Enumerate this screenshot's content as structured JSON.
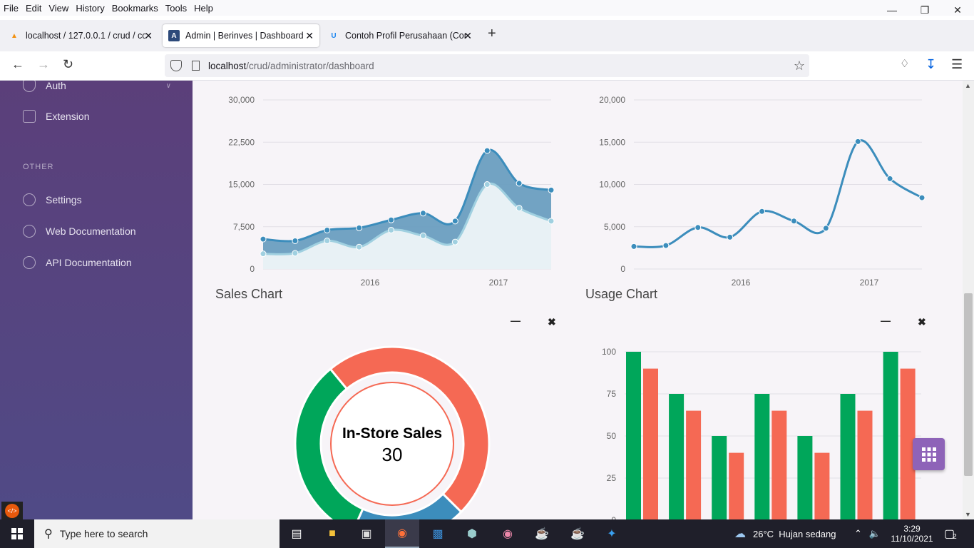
{
  "menubar": {
    "items": [
      "File",
      "Edit",
      "View",
      "History",
      "Bookmarks",
      "Tools",
      "Help"
    ]
  },
  "tabs": [
    {
      "label": "localhost / 127.0.0.1 / crud / cc_",
      "active": false
    },
    {
      "label": "Admin | Berinves | Dashboard",
      "active": true
    },
    {
      "label": "Contoh Profil Perusahaan (Com",
      "active": false
    }
  ],
  "url": {
    "host": "localhost",
    "path": "/crud/administrator/dashboard"
  },
  "sidebar": {
    "items_top": [
      {
        "label": "Auth"
      },
      {
        "label": "Extension"
      }
    ],
    "section": "OTHER",
    "items_other": [
      {
        "label": "Settings"
      },
      {
        "label": "Web Documentation"
      },
      {
        "label": "API Documentation"
      }
    ]
  },
  "charts": {
    "sales_title": "Sales Chart",
    "usage_title": "Usage Chart",
    "donut_label": "In-Store Sales",
    "donut_value": "30"
  },
  "chart_data": [
    {
      "type": "area",
      "x_ticks": [
        "2016",
        "2017"
      ],
      "y_ticks": [
        "0",
        "7,500",
        "15,000",
        "22,500",
        "30,000"
      ],
      "ylim": [
        0,
        30000
      ],
      "series": [
        {
          "values": [
            5300,
            5000,
            6900,
            7300,
            8700,
            9900,
            8500,
            21000,
            15200,
            14000
          ],
          "color": "#3c8dbc"
        },
        {
          "values": [
            2700,
            2800,
            5000,
            3900,
            6900,
            5900,
            4800,
            15000,
            10800,
            8500
          ],
          "color": "#a0d0e0"
        }
      ]
    },
    {
      "type": "line",
      "x_ticks": [
        "2016",
        "2017"
      ],
      "y_ticks": [
        "0",
        "5,000",
        "10,000",
        "15,000",
        "20,000"
      ],
      "ylim": [
        0,
        20000
      ],
      "series": [
        {
          "values": [
            2666,
            2778,
            4912,
            3767,
            6810,
            5670,
            4820,
            15073,
            10687,
            8432
          ],
          "color": "#3c8dbc"
        }
      ]
    },
    {
      "type": "pie",
      "slices": [
        {
          "value": 30,
          "color": "#f56954"
        },
        {
          "value": 12,
          "color": "#3c8dbc"
        },
        {
          "value": 20,
          "color": "#00a65a"
        }
      ]
    },
    {
      "type": "bar",
      "y_ticks": [
        "0",
        "25",
        "50",
        "75",
        "100"
      ],
      "ylim": [
        0,
        100
      ],
      "series": [
        {
          "values": [
            100,
            75,
            50,
            75,
            50,
            75,
            100
          ],
          "color": "#00a65a"
        },
        {
          "values": [
            90,
            65,
            40,
            65,
            40,
            65,
            90
          ],
          "color": "#f56954"
        }
      ]
    }
  ],
  "taskbar": {
    "search_placeholder": "Type here to search",
    "weather": "26°C  Hujan sedang",
    "time": "3:29",
    "date": "11/10/2021",
    "notifications": "2"
  }
}
